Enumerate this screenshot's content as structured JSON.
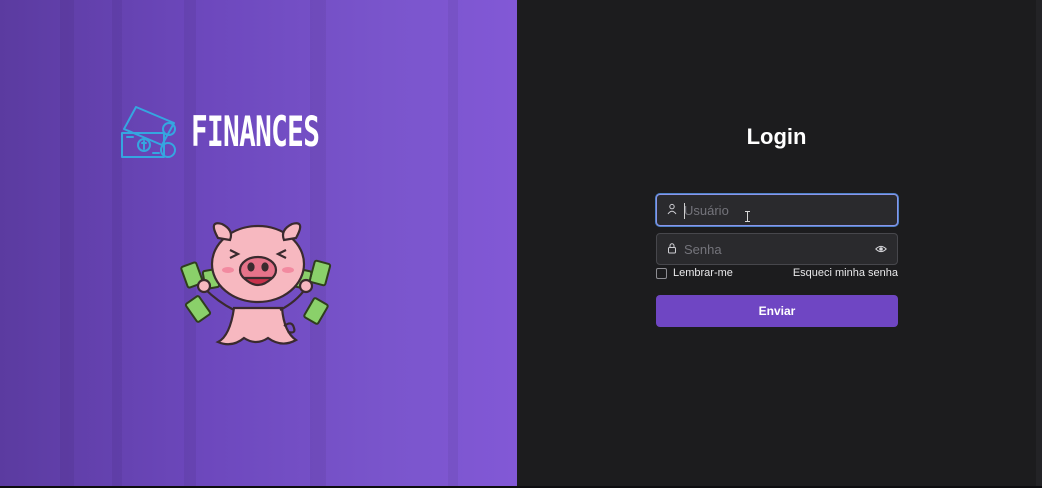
{
  "brand": {
    "name": "FINANCES",
    "logo_icon": "money-bill-coin-icon",
    "mascot": "pig-with-money-illustration"
  },
  "login": {
    "title": "Login",
    "username": {
      "placeholder": "Usuário",
      "value": "",
      "icon": "user-icon"
    },
    "password": {
      "placeholder": "Senha",
      "value": "",
      "icon": "lock-icon",
      "toggle_icon": "eye-icon"
    },
    "remember_label": "Lembrar-me",
    "forgot_label": "Esqueci minha senha",
    "submit_label": "Enviar"
  },
  "colors": {
    "panel_purple": "#7a55cc",
    "dark_background": "#1c1c1e",
    "button_purple": "#6f46c3",
    "focus_border": "#8a95ea"
  }
}
